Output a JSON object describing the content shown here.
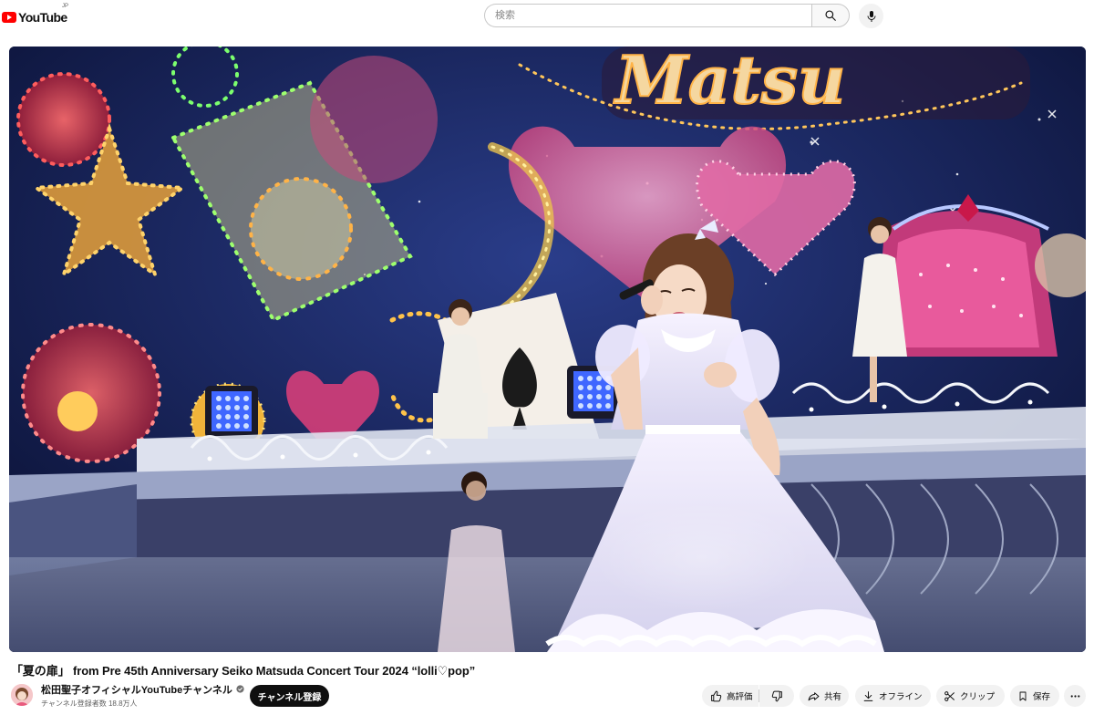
{
  "masthead": {
    "logo_text": "YouTube",
    "logo_region": "JP",
    "search_placeholder": "検索",
    "search_icon": "search-icon",
    "mic_icon": "microphone-icon"
  },
  "player": {
    "content": "concert-video-frame"
  },
  "video": {
    "title": "「夏の扉」 from Pre 45th Anniversary Seiko Matsuda Concert Tour 2024 “lolli♡pop”"
  },
  "channel": {
    "name": "松田聖子オフィシャルYouTubeチャンネル",
    "verified_icon": "verified-check-icon",
    "subscribers": "チャンネル登録者数 18.8万人",
    "subscribe_label": "チャンネル登録"
  },
  "actions": {
    "like_label": "高評価",
    "share_label": "共有",
    "download_label": "オフライン",
    "clip_label": "クリップ",
    "save_label": "保存"
  },
  "colors": {
    "brand_red": "#ff0000",
    "text_primary": "#0f0f0f",
    "text_secondary": "#606060",
    "chip_bg": "#f2f2f2",
    "subscribe_bg": "#0f0f0f"
  }
}
